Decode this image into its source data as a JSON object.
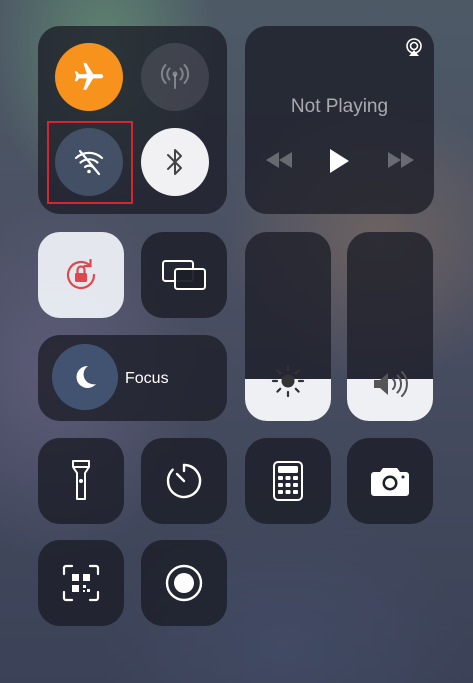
{
  "connectivity": {
    "airplane_icon": "airplane-icon",
    "cellular_icon": "cellular-antenna-icon",
    "wifi_icon": "wifi-off-icon",
    "bluetooth_icon": "bluetooth-icon",
    "airplane_color": "#f7931c"
  },
  "media": {
    "title": "Not Playing",
    "airplay_icon": "airplay-icon",
    "controls": [
      "rewind-icon",
      "play-icon",
      "fast-forward-icon"
    ]
  },
  "focus": {
    "label": "Focus",
    "icon": "moon-icon"
  },
  "sliders": {
    "brightness_level": 0.22,
    "volume_level": 0.22
  },
  "tiles": [
    "orientation-lock-icon",
    "screen-mirroring-icon",
    "flashlight-icon",
    "timer-icon",
    "calculator-icon",
    "camera-icon",
    "qr-scanner-icon",
    "screen-record-icon"
  ],
  "annotation_color": "#d8252d"
}
